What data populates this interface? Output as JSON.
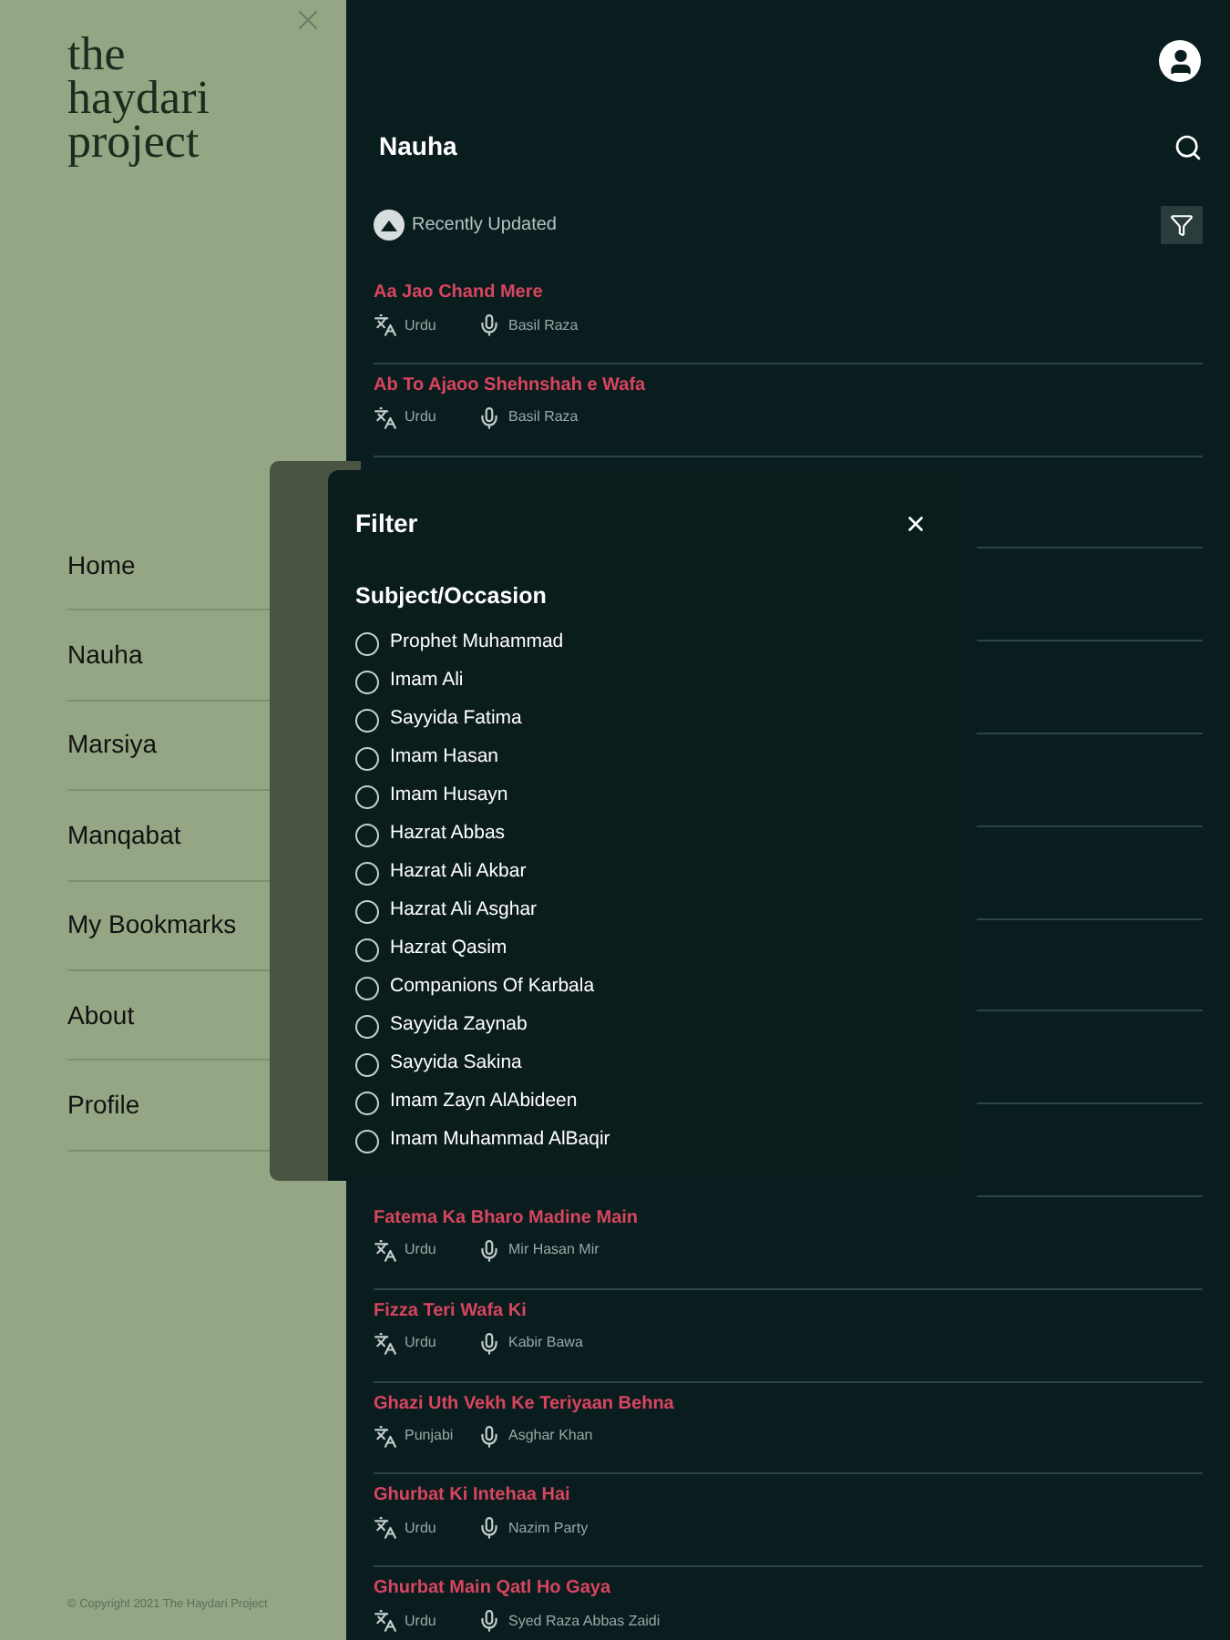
{
  "sidebar": {
    "logo": [
      "the",
      "haydari",
      "project"
    ],
    "items": [
      "Home",
      "Nauha",
      "Marsiya",
      "Manqabat",
      "My Bookmarks",
      "About",
      "Profile"
    ],
    "copyright": "© Copyright 2021 The Haydari Project"
  },
  "header": {
    "title": "Nauha",
    "sort": "Recently Updated"
  },
  "rows_top": [
    {
      "title": "Aa Jao Chand Mere",
      "language": "Urdu",
      "reciter": "Basil Raza"
    },
    {
      "title": "Ab To Ajaoo Shehnshah e Wafa",
      "language": "Urdu",
      "reciter": "Basil Raza"
    }
  ],
  "rows_bottom": [
    {
      "title": "Fatema Ka Bharo Madine Main",
      "language": "Urdu",
      "reciter": "Mir Hasan Mir"
    },
    {
      "title": "Fizza Teri Wafa Ki",
      "language": "Urdu",
      "reciter": "Kabir Bawa"
    },
    {
      "title": "Ghazi Uth Vekh Ke Teriyaan Behna",
      "language": "Punjabi",
      "reciter": "Asghar Khan"
    },
    {
      "title": "Ghurbat Ki Intehaa Hai",
      "language": "Urdu",
      "reciter": "Nazim Party"
    },
    {
      "title": "Ghurbat Main Qatl Ho Gaya",
      "language": "Urdu",
      "reciter": "Syed Raza Abbas Zaidi"
    }
  ],
  "filter": {
    "title": "Filter",
    "section": "Subject/Occasion",
    "options": [
      {
        "label": "Prophet Muhammad",
        "selected": false
      },
      {
        "label": "Imam Ali",
        "selected": false
      },
      {
        "label": "Sayyida Fatima",
        "selected": false
      },
      {
        "label": "Imam Hasan",
        "selected": false
      },
      {
        "label": "Imam Husayn",
        "selected": false
      },
      {
        "label": "Hazrat Abbas",
        "selected": false
      },
      {
        "label": "Hazrat Ali Akbar",
        "selected": false
      },
      {
        "label": "Hazrat Ali Asghar",
        "selected": false
      },
      {
        "label": "Hazrat Qasim",
        "selected": false
      },
      {
        "label": "Companions Of Karbala",
        "selected": false
      },
      {
        "label": "Sayyida Zaynab",
        "selected": false
      },
      {
        "label": "Sayyida Sakina",
        "selected": false
      },
      {
        "label": "Imam Zayn AlAbideen",
        "selected": false
      },
      {
        "label": "Imam Muhammad AlBaqir",
        "selected": false
      }
    ]
  }
}
